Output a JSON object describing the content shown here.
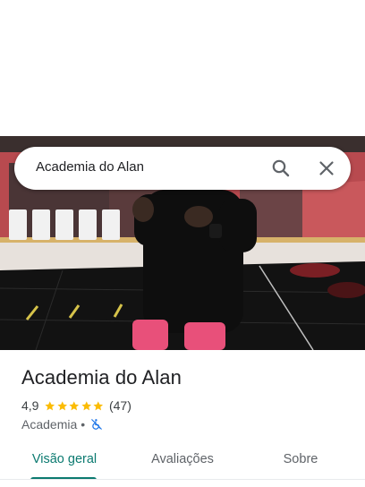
{
  "search": {
    "query": "Academia do Alan"
  },
  "place": {
    "name": "Academia do Alan",
    "rating": "4,9",
    "stars": 5,
    "review_count": "(47)",
    "category": "Academia",
    "separator": "•",
    "accessibility_icon": "wheelchair-not-accessible-icon"
  },
  "tabs": [
    {
      "label": "Visão geral",
      "active": true
    },
    {
      "label": "Avaliações",
      "active": false
    },
    {
      "label": "Sobre",
      "active": false
    }
  ],
  "colors": {
    "accent": "#0b7a70",
    "star": "#fbbc04",
    "no_access_icon": "#1a73e8"
  }
}
